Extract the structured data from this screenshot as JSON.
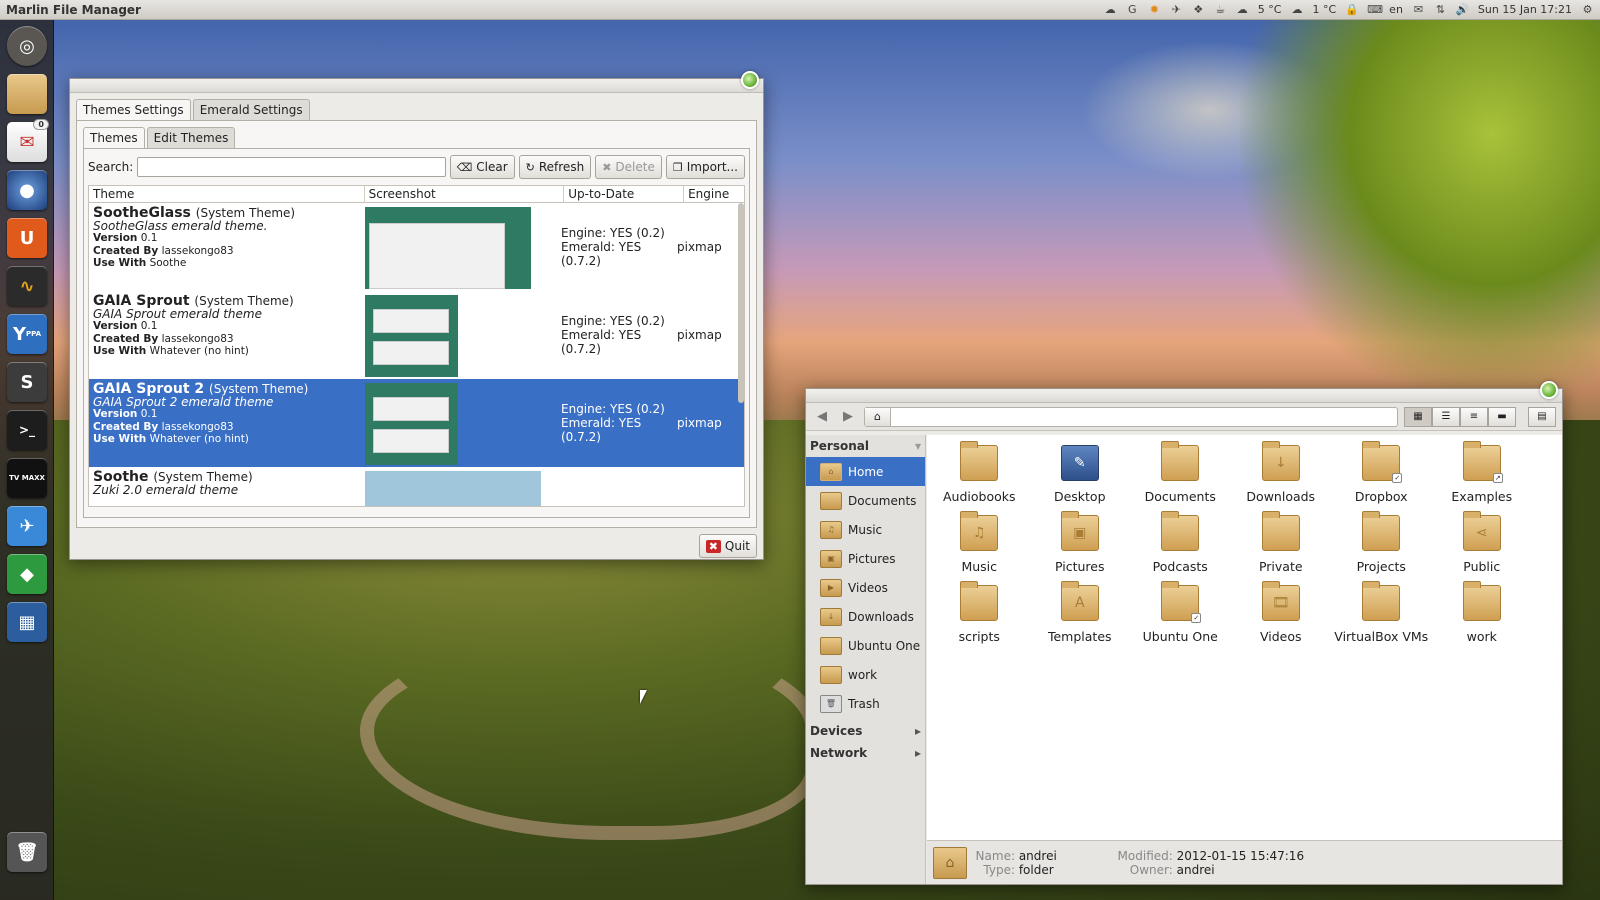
{
  "panel": {
    "app_title": "Marlin File Manager",
    "temp1": "5 °C",
    "temp2": "1 °C",
    "keyboard": "en",
    "clock": "Sun 15 Jan 17:21"
  },
  "launcher": {
    "mail_badge": "0",
    "ppa_label": "PPA",
    "tv_label": "TV MAXX",
    "s_label": "S",
    "u_label": "U",
    "y_label": "Y",
    "terminal_label": ">_"
  },
  "emerald": {
    "tabs": [
      "Themes Settings",
      "Emerald Settings"
    ],
    "subtabs": [
      "Themes",
      "Edit Themes"
    ],
    "search_label": "Search:",
    "search_value": "",
    "buttons": {
      "clear": "Clear",
      "refresh": "Refresh",
      "delete": "Delete",
      "import": "Import..."
    },
    "columns": [
      "Theme",
      "Screenshot",
      "Up-to-Date",
      "Engine"
    ],
    "rows": [
      {
        "name": "SootheGlass",
        "tag": "(System Theme)",
        "desc": "SootheGlass emerald theme.",
        "version_label": "Version",
        "version": "0.1",
        "created_label": "Created By",
        "author": "lassekongo83",
        "use_label": "Use With",
        "use": "Soothe",
        "engine_status": "Engine: YES (0.2)",
        "emerald_status": "Emerald: YES (0.7.2)",
        "engine": "pixmap"
      },
      {
        "name": "GAIA Sprout",
        "tag": "(System Theme)",
        "desc": "GAIA Sprout emerald theme",
        "version_label": "Version",
        "version": "0.1",
        "created_label": "Created By",
        "author": "lassekongo83",
        "use_label": "Use With",
        "use": "Whatever (no hint)",
        "engine_status": "Engine: YES (0.2)",
        "emerald_status": "Emerald: YES (0.7.2)",
        "engine": "pixmap"
      },
      {
        "name": "GAIA Sprout 2",
        "tag": "(System Theme)",
        "desc": "GAIA Sprout 2 emerald theme",
        "version_label": "Version",
        "version": "0.1",
        "created_label": "Created By",
        "author": "lassekongo83",
        "use_label": "Use With",
        "use": "Whatever (no hint)",
        "engine_status": "Engine: YES (0.2)",
        "emerald_status": "Emerald: YES (0.7.2)",
        "engine": "pixmap"
      },
      {
        "name": "Soothe",
        "tag": "(System Theme)",
        "desc": "Zuki 2.0 emerald theme"
      }
    ],
    "quit": "Quit"
  },
  "filemanager": {
    "sidebar": {
      "personal": "Personal",
      "items": [
        "Home",
        "Documents",
        "Music",
        "Pictures",
        "Videos",
        "Downloads",
        "Ubuntu One",
        "work",
        "Trash"
      ],
      "devices": "Devices",
      "network": "Network"
    },
    "files": [
      "Audiobooks",
      "Desktop",
      "Documents",
      "Downloads",
      "Dropbox",
      "Examples",
      "Music",
      "Pictures",
      "Podcasts",
      "Private",
      "Projects",
      "Public",
      "scripts",
      "Templates",
      "Ubuntu One",
      "Videos",
      "VirtualBox VMs",
      "work"
    ],
    "status": {
      "name_label": "Name:",
      "name": "andrei",
      "type_label": "Type:",
      "type": "folder",
      "modified_label": "Modified:",
      "modified": "2012-01-15 15:47:16",
      "owner_label": "Owner:",
      "owner": "andrei"
    }
  },
  "colors": {
    "selection": "#3a6fc6",
    "folder": "#d9b06a",
    "panel": "#e8e6e2"
  }
}
